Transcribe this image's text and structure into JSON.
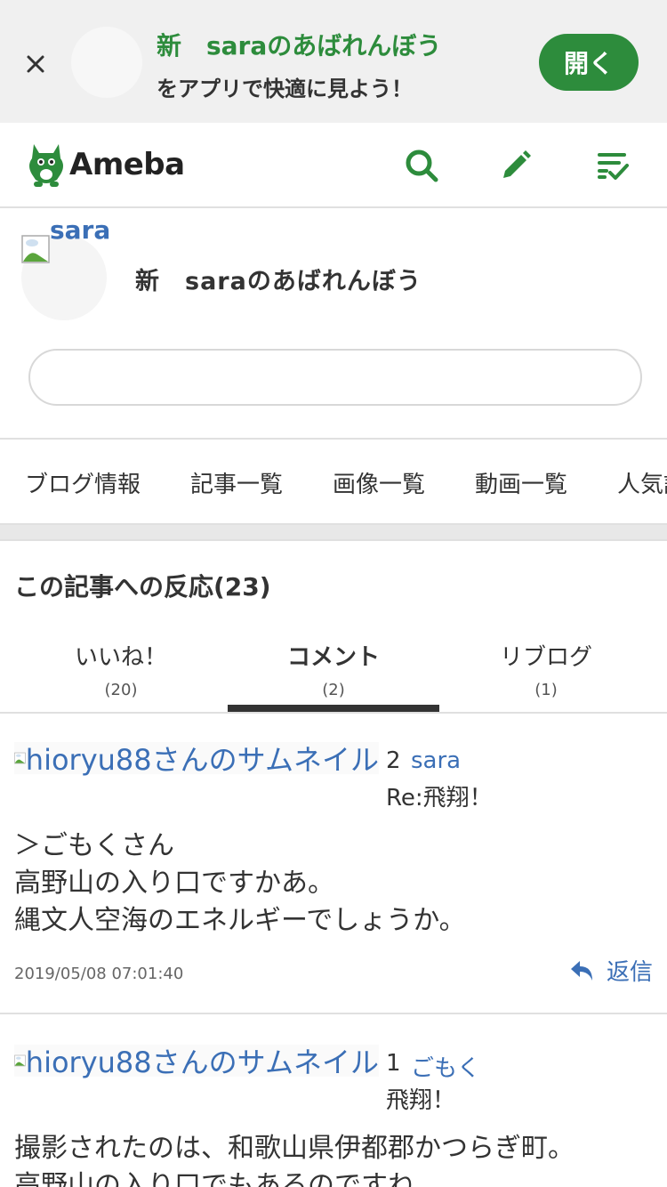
{
  "banner": {
    "title": "新　saraのあばれんぼう",
    "subtitle": "をアプリで快適に見よう！",
    "open_label": "開く"
  },
  "header": {
    "logo_text": "Ameba",
    "icons": [
      "search-icon",
      "pencil-icon",
      "checklist-icon"
    ],
    "accent_color": "#2d8c3c"
  },
  "profile": {
    "avatar_alt": "sara",
    "blog_title": "新　saraのあばれんぼう",
    "search_value": ""
  },
  "nav": {
    "items": [
      "ブログ情報",
      "記事一覧",
      "画像一覧",
      "動画一覧",
      "人気記事"
    ]
  },
  "reactions": {
    "title": "この記事への反応(23)",
    "tabs": [
      {
        "label": "いいね！",
        "count": "(20)"
      },
      {
        "label": "コメント",
        "count": "(2)"
      },
      {
        "label": "リブログ",
        "count": "(1)"
      }
    ],
    "active_tab": "コメント"
  },
  "comments": [
    {
      "thumb_alt": "hioryu88さんのサムネイル",
      "number": "2",
      "author": "sara",
      "subject": "Re:飛翔！",
      "body_lines": [
        "＞ごもくさん",
        "高野山の入り口ですかあ。",
        "縄文人空海のエネルギーでしょうか。"
      ],
      "date": "2019/05/08 07:01:40",
      "reply_label": "返信"
    },
    {
      "thumb_alt": "hioryu88さんのサムネイル",
      "number": "1",
      "author": "ごもく",
      "subject": "飛翔！",
      "body_lines": [
        "撮影されたのは、和歌山県伊都郡かつらぎ町。",
        "高野山の入り口でもあるのですね。"
      ]
    }
  ]
}
